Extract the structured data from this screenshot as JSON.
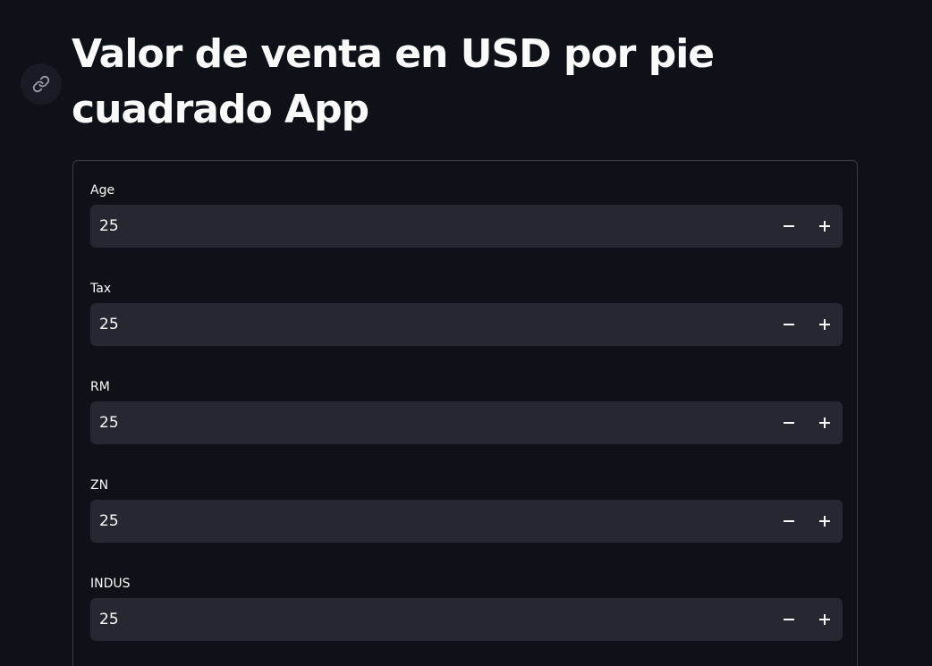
{
  "page": {
    "title": "Valor de venta en USD por pie cuadrado App"
  },
  "icons": {
    "anchor": "link-icon",
    "decrement": "minus-icon",
    "increment": "plus-icon"
  },
  "colors": {
    "background": "#0e1117",
    "input_background": "#262730",
    "text": "#fafafa",
    "border": "#3a3d47"
  },
  "form": {
    "fields": [
      {
        "label": "Age",
        "value": "25"
      },
      {
        "label": "Tax",
        "value": "25"
      },
      {
        "label": "RM",
        "value": "25"
      },
      {
        "label": "ZN",
        "value": "25"
      },
      {
        "label": "INDUS",
        "value": "25"
      }
    ]
  }
}
